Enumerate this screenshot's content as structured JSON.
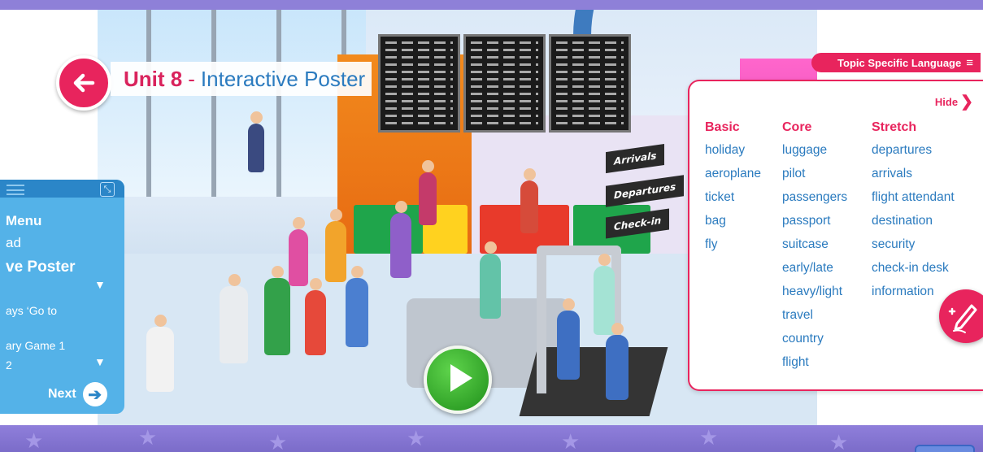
{
  "header": {
    "unit_label": "Unit 8",
    "separator": "-",
    "title": "Interactive Poster"
  },
  "poster": {
    "signs": [
      "Arrivals",
      "Departures",
      "Check-in"
    ]
  },
  "topic_panel": {
    "tab_label": "Topic Specific Language",
    "hide_label": "Hide",
    "columns": [
      {
        "heading": "Basic",
        "words": [
          "holiday",
          "aeroplane",
          "ticket",
          "bag",
          "fly"
        ]
      },
      {
        "heading": "Core",
        "words": [
          "luggage",
          "pilot",
          "passengers",
          "passport",
          "suitcase",
          "early/late",
          "heavy/light",
          "travel",
          "country",
          "flight"
        ]
      },
      {
        "heading": "Stretch",
        "words": [
          "departures",
          "arrivals",
          "flight attendant",
          "destination",
          "security",
          "check-in desk",
          "information"
        ]
      }
    ]
  },
  "side_menu": {
    "items": [
      "Menu",
      "ad",
      "ve Poster",
      "ays ‘Go to",
      "ary Game 1",
      "2"
    ],
    "next_label": "Next"
  },
  "colors": {
    "accent_pink": "#e8245d",
    "word_blue": "#2b7bbf",
    "menu_blue": "#54b2e8",
    "band_purple": "#8e80d8"
  },
  "icons": {
    "back": "arrow-left-icon",
    "menu_toggle": "hamburger-icon",
    "hide": "chevron-right-icon",
    "play": "play-icon",
    "edit": "pen-icon",
    "next": "arrow-right-circle-icon"
  }
}
